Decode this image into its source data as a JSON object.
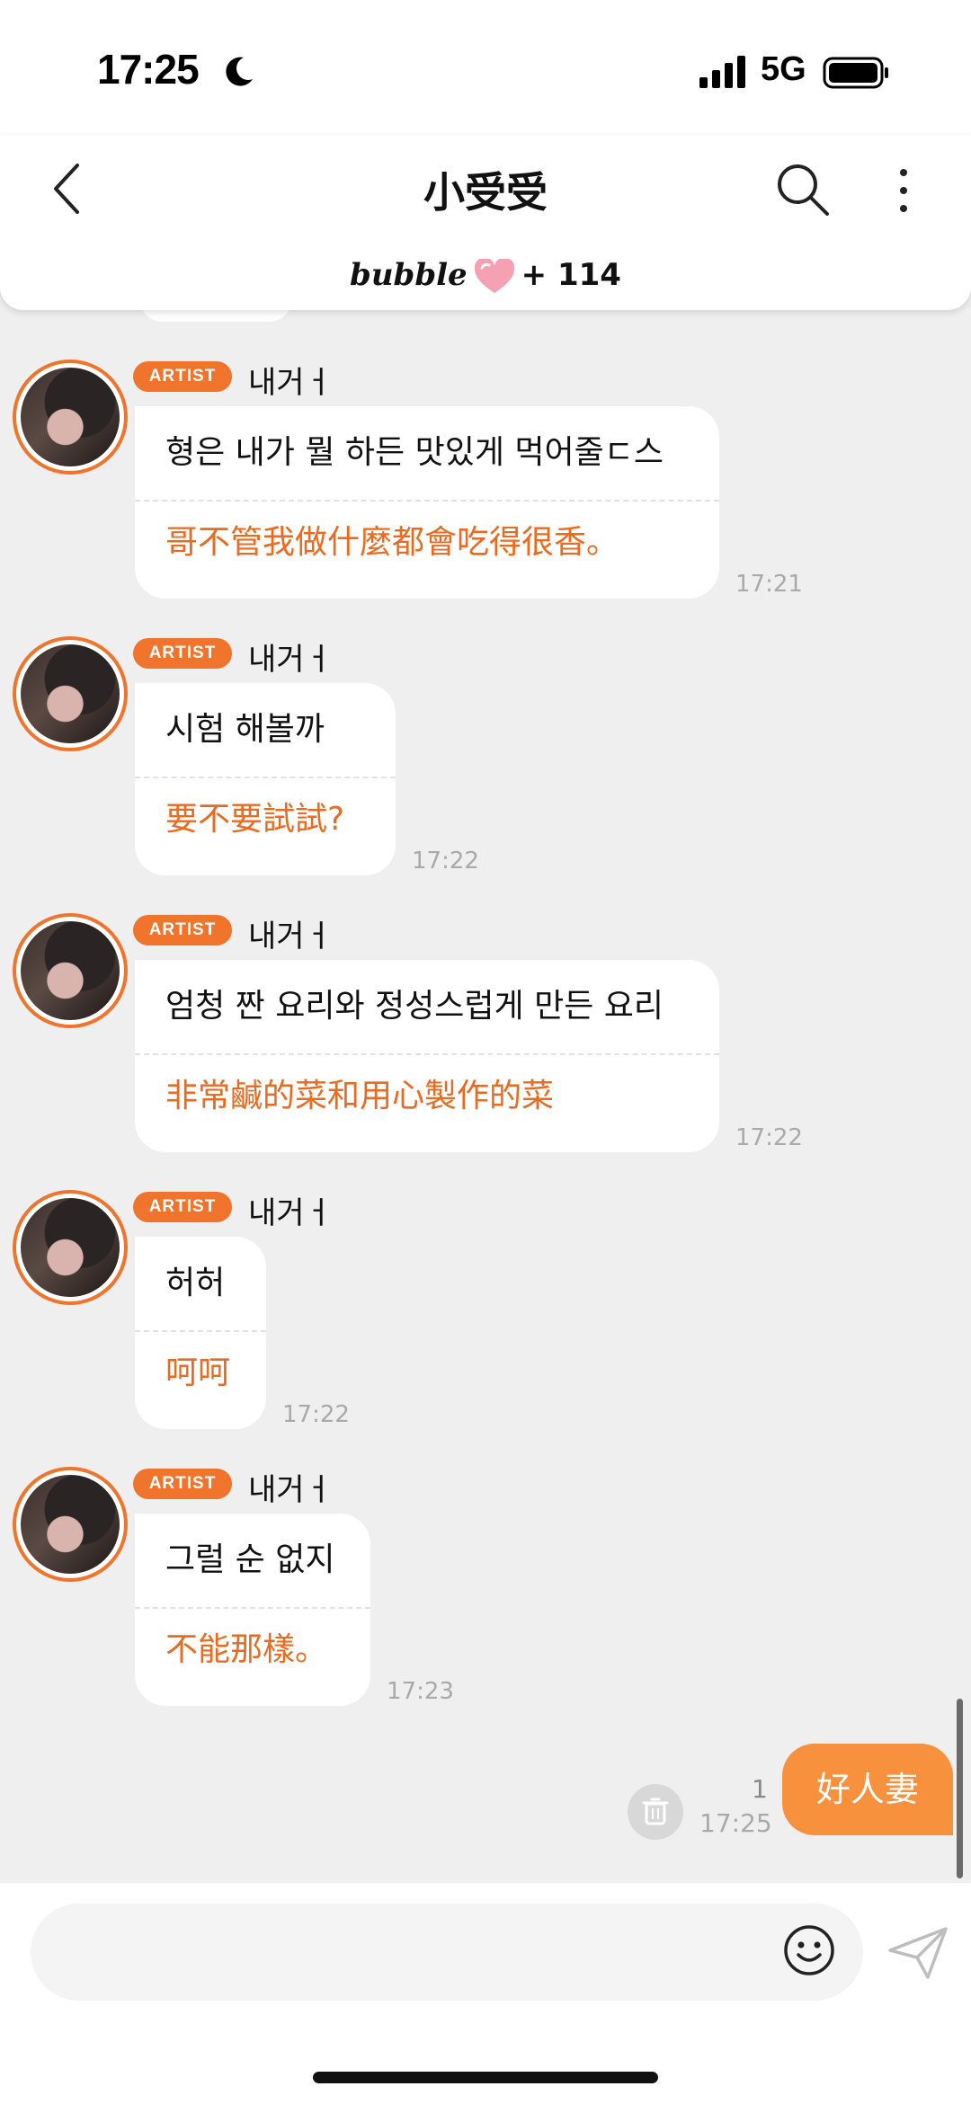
{
  "status": {
    "time": "17:25",
    "network": "5G"
  },
  "header": {
    "title": "小受受",
    "brand": "bubble",
    "count": "+ 114"
  },
  "messages": [
    {
      "badge": "ARTIST",
      "name": "내거ㅓ",
      "ko": "형은 내가 뭘 하든 맛있게 먹어줄ㄷ스",
      "zh": "哥不管我做什麼都會吃得很香。",
      "time": "17:21"
    },
    {
      "badge": "ARTIST",
      "name": "내거ㅓ",
      "ko": "시험 해볼까",
      "zh": "要不要試試?",
      "time": "17:22"
    },
    {
      "badge": "ARTIST",
      "name": "내거ㅓ",
      "ko": "엄청 짠 요리와 정성스럽게 만든 요리",
      "zh": "非常鹹的菜和用心製作的菜",
      "time": "17:22"
    },
    {
      "badge": "ARTIST",
      "name": "내거ㅓ",
      "ko": "허허",
      "zh": "呵呵",
      "time": "17:22"
    },
    {
      "badge": "ARTIST",
      "name": "내거ㅓ",
      "ko": "그럴 순 없지",
      "zh": "不能那樣。",
      "time": "17:23"
    }
  ],
  "mine": {
    "text": "好人妻",
    "read_count": "1",
    "time": "17:25"
  },
  "composer": {
    "placeholder": ""
  }
}
